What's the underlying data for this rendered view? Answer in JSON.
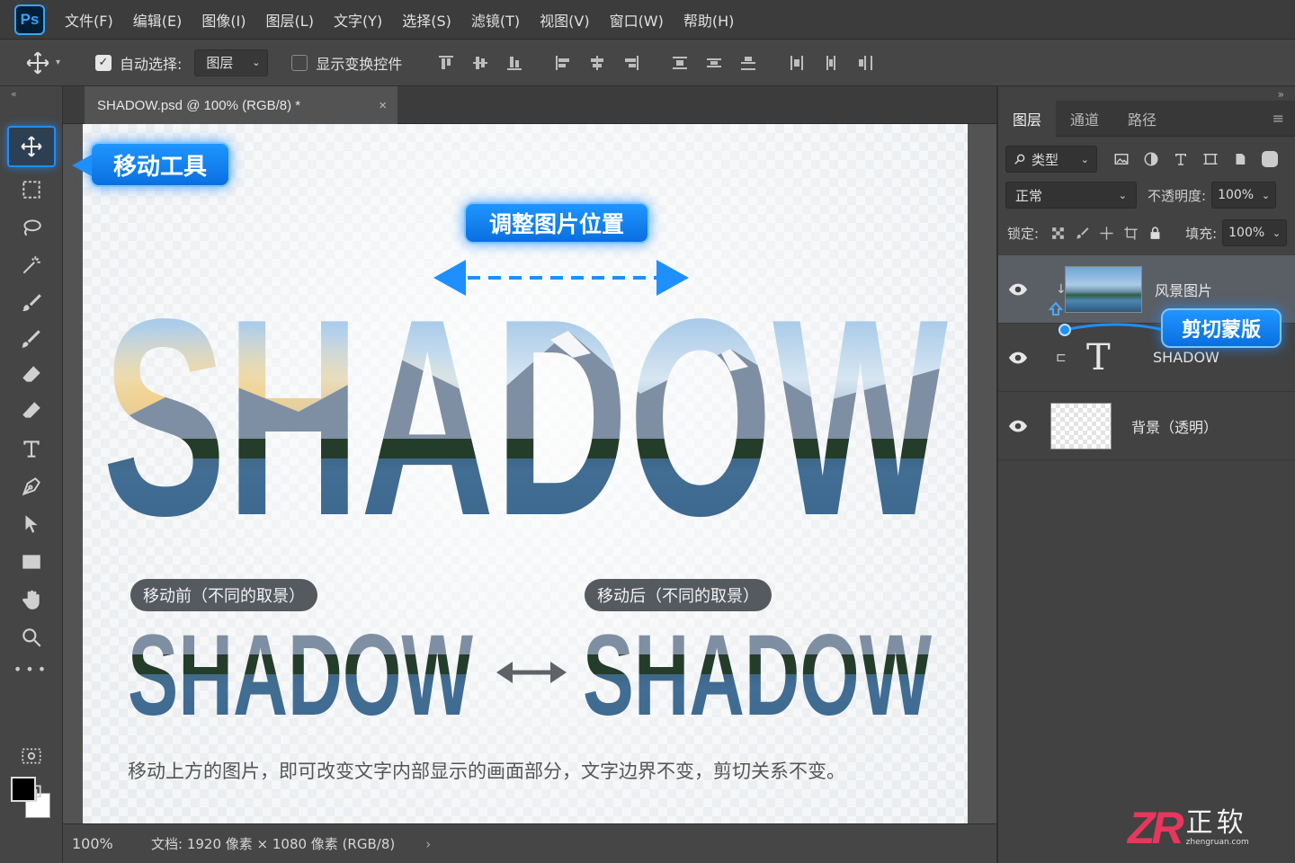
{
  "app": {
    "logo": "Ps"
  },
  "menu": [
    "文件(F)",
    "编辑(E)",
    "图像(I)",
    "图层(L)",
    "文字(Y)",
    "选择(S)",
    "滤镜(T)",
    "视图(V)",
    "窗口(W)",
    "帮助(H)"
  ],
  "options_bar": {
    "auto_select_label": "自动选择:",
    "auto_select_checked": true,
    "auto_select_target": "图层",
    "show_transform_label": "显示变换控件",
    "show_transform_checked": false
  },
  "document": {
    "tab_title": "SHADOW.psd @ 100% (RGB/8) *",
    "close_glyph": "×"
  },
  "canvas": {
    "callout_move_tool": "移动工具",
    "callout_adjust": "调整图片位置",
    "headline": "SHADOW",
    "before_label": "移动前（不同的取景）",
    "after_label": "移动后（不同的取景）",
    "before_word": "SHADOW",
    "after_word": "SHADOW",
    "caption": "移动上方的图片，即可改变文字内部显示的画面部分，文字边界不变，剪切关系不变。"
  },
  "status": {
    "zoom": "100%",
    "doc_info": "文档: 1920 像素 × 1080 像素 (RGB/8)",
    "arrow": "›"
  },
  "layers_panel": {
    "tabs": [
      "图层",
      "通道",
      "路径"
    ],
    "active_tab": 0,
    "filter_kind": "类型",
    "blend_mode": "正常",
    "opacity_label": "不透明度:",
    "opacity_value": "100%",
    "lock_label": "锁定:",
    "fill_label": "填充:",
    "fill_value": "100%",
    "clip_callout": "剪切蒙版",
    "layers": [
      {
        "name": "风景图片",
        "type": "image",
        "visible": true,
        "selected": true,
        "clipped": true
      },
      {
        "name": "SHADOW",
        "type": "text",
        "visible": true,
        "selected": false,
        "glyph": "T"
      },
      {
        "name": "背景（透明）",
        "type": "transparent",
        "visible": true,
        "selected": false
      }
    ]
  },
  "brand": {
    "logo": "ZR",
    "name": "正软",
    "url": "zhengruan.com"
  },
  "colors": {
    "accent": "#1e8fff",
    "panel": "#424242",
    "menubar": "#3c3c3c",
    "brand": "#e8365d"
  }
}
